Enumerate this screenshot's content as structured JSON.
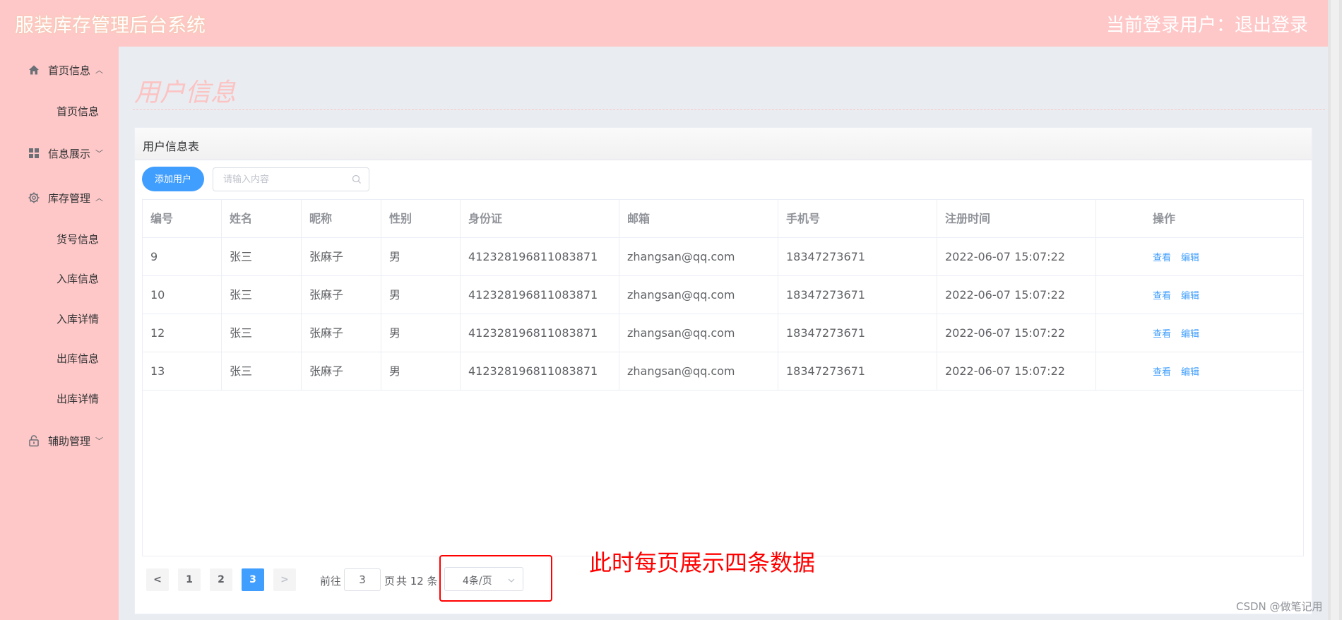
{
  "header": {
    "app_title": "服装库存管理后台系统",
    "user_area": "当前登录用户：退出登录"
  },
  "sidebar": {
    "groups": [
      {
        "label": "首页信息",
        "icon": "home-icon",
        "arrow": "^"
      },
      {
        "label": "信息展示",
        "icon": "grid-icon",
        "arrow": "v"
      },
      {
        "label": "库存管理",
        "icon": "gear-icon",
        "arrow": "^"
      },
      {
        "label": "辅助管理",
        "icon": "lock-icon",
        "arrow": "v"
      }
    ],
    "items": [
      "首页信息",
      "货号信息",
      "入库信息",
      "入库详情",
      "出库信息",
      "出库详情"
    ]
  },
  "main": {
    "heading": "用户信息",
    "card_title": "用户信息表",
    "add_button": "添加用户",
    "search_placeholder": "请输入内容"
  },
  "table": {
    "columns": [
      "编号",
      "姓名",
      "昵称",
      "性别",
      "身份证",
      "邮箱",
      "手机号",
      "注册时间",
      "操作"
    ],
    "rows": [
      [
        "9",
        "张三",
        "张麻子",
        "男",
        "412328196811083871",
        "zhangsan@qq.com",
        "18347273671",
        "2022-06-07 15:07:22"
      ],
      [
        "10",
        "张三",
        "张麻子",
        "男",
        "412328196811083871",
        "zhangsan@qq.com",
        "18347273671",
        "2022-06-07 15:07:22"
      ],
      [
        "12",
        "张三",
        "张麻子",
        "男",
        "412328196811083871",
        "zhangsan@qq.com",
        "18347273671",
        "2022-06-07 15:07:22"
      ],
      [
        "13",
        "张三",
        "张麻子",
        "男",
        "412328196811083871",
        "zhangsan@qq.com",
        "18347273671",
        "2022-06-07 15:07:22"
      ]
    ],
    "actions": [
      "查看",
      "编辑"
    ]
  },
  "pagination": {
    "prev": "<",
    "next": ">",
    "pages": [
      "1",
      "2",
      "3"
    ],
    "current_page": "3",
    "goto_prefix": "前往",
    "goto_value": "3",
    "goto_suffix": "页",
    "total": "共 12 条",
    "page_size": "4条/页"
  },
  "annotation": {
    "note": "此时每页展示四条数据",
    "color": "#ff0000"
  },
  "watermark": "CSDN @做笔记用",
  "colors": {
    "pink": "#fec8c8",
    "primary": "#409eff",
    "main_bg": "#e9edf2"
  }
}
